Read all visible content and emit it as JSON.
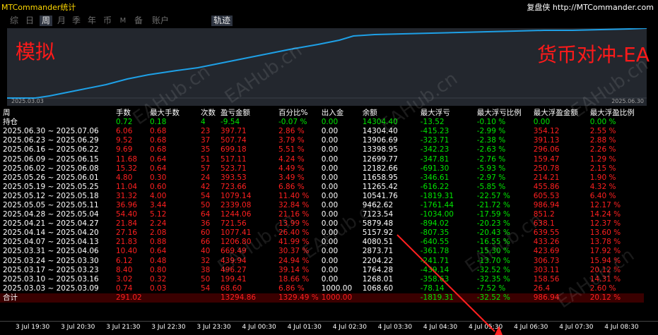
{
  "app": {
    "title": "MTCommander统计",
    "brand": "复盘侠",
    "url": "http://MTCommander.com"
  },
  "tabs": [
    "综",
    "日",
    "周",
    "月",
    "季",
    "年",
    "币",
    "M",
    "备",
    "账户",
    "轨迹"
  ],
  "active_tab": "周",
  "chart": {
    "label_left": "模拟",
    "label_right": "货币对冲-EA",
    "start_date": "2025.03.03",
    "end_date": "2025.06.30"
  },
  "watermark": "EAHub.cn",
  "table": {
    "headers": [
      "周",
      "手数",
      "最大手数",
      "次数",
      "盈亏金额",
      "百分比%",
      "出入金",
      "余额",
      "最大浮亏",
      "最大浮亏比例",
      "最大浮盈金额",
      "最大浮盈比例"
    ],
    "holdings": [
      "持仓",
      "0.72",
      "0.18",
      "4",
      "-9.54",
      "-0.07 %",
      "0.00",
      "14304.40",
      "-13.52",
      "-0.10 %",
      "0.00",
      "0.00 %"
    ],
    "rows": [
      [
        "2025.06.30 ~ 2025.07.06",
        "6.06",
        "0.68",
        "23",
        "397.71",
        "2.86 %",
        "0.00",
        "14304.40",
        "-415.23",
        "-2.99 %",
        "354.12",
        "2.55 %"
      ],
      [
        "2025.06.23 ~ 2025.06.29",
        "9.52",
        "0.68",
        "37",
        "507.74",
        "3.79 %",
        "0.00",
        "13906.69",
        "-323.71",
        "-2.38 %",
        "391.13",
        "2.88 %"
      ],
      [
        "2025.06.16 ~ 2025.06.22",
        "9.69",
        "0.68",
        "35",
        "699.18",
        "5.51 %",
        "0.00",
        "13398.95",
        "-342.23",
        "-2.63 %",
        "296.06",
        "2.26 %"
      ],
      [
        "2025.06.09 ~ 2025.06.15",
        "11.68",
        "0.64",
        "51",
        "517.11",
        "4.24 %",
        "0.00",
        "12699.77",
        "-347.81",
        "-2.76 %",
        "159.47",
        "1.29 %"
      ],
      [
        "2025.06.02 ~ 2025.06.08",
        "15.32",
        "0.64",
        "57",
        "523.71",
        "4.49 %",
        "0.00",
        "12182.66",
        "-691.30",
        "-5.93 %",
        "250.78",
        "2.15 %"
      ],
      [
        "2025.05.26 ~ 2025.06.01",
        "4.80",
        "0.30",
        "24",
        "393.53",
        "3.49 %",
        "0.00",
        "11658.95",
        "-346.61",
        "-2.97 %",
        "214.21",
        "1.90 %"
      ],
      [
        "2025.05.19 ~ 2025.05.25",
        "11.04",
        "0.60",
        "42",
        "723.66",
        "6.86 %",
        "0.00",
        "11265.42",
        "-616.22",
        "-5.85 %",
        "455.86",
        "4.32 %"
      ],
      [
        "2025.05.12 ~ 2025.05.18",
        "31.32",
        "4.00",
        "54",
        "1079.14",
        "11.40 %",
        "0.00",
        "10541.76",
        "-1819.31",
        "-22.57 %",
        "605.53",
        "6.40 %"
      ],
      [
        "2025.05.05 ~ 2025.05.11",
        "36.96",
        "3.44",
        "50",
        "2339.08",
        "32.84 %",
        "0.00",
        "9462.62",
        "-1761.44",
        "-21.72 %",
        "986.94",
        "12.17 %"
      ],
      [
        "2025.04.28 ~ 2025.05.04",
        "54.40",
        "5.12",
        "64",
        "1244.06",
        "21.16 %",
        "0.00",
        "7123.54",
        "-1034.00",
        "-17.59 %",
        "851.2",
        "14.24 %"
      ],
      [
        "2025.04.21 ~ 2025.04.27",
        "21.84",
        "2.24",
        "36",
        "721.56",
        "13.99 %",
        "0.00",
        "5879.48",
        "-894.02",
        "-20.23 %",
        "638.1",
        "12.37 %"
      ],
      [
        "2025.04.14 ~ 2025.04.20",
        "27.16",
        "2.08",
        "60",
        "1077.41",
        "26.40 %",
        "0.00",
        "5157.92",
        "-807.35",
        "-20.43 %",
        "639.55",
        "13.60 %"
      ],
      [
        "2025.04.07 ~ 2025.04.13",
        "21.83",
        "0.88",
        "66",
        "1206.80",
        "41.99 %",
        "0.00",
        "4080.51",
        "-640.55",
        "-16.55 %",
        "433.26",
        "13.78 %"
      ],
      [
        "2025.03.31 ~ 2025.04.06",
        "10.40",
        "0.64",
        "40",
        "669.49",
        "30.37 %",
        "0.00",
        "2873.71",
        "-361.78",
        "-15.30 %",
        "423.69",
        "17.92 %"
      ],
      [
        "2025.03.24 ~ 2025.03.30",
        "6.12",
        "0.48",
        "32",
        "439.94",
        "24.94 %",
        "0.00",
        "2204.22",
        "-241.71",
        "-13.70 %",
        "306.73",
        "15.94 %"
      ],
      [
        "2025.03.17 ~ 2025.03.23",
        "8.40",
        "0.80",
        "38",
        "496.27",
        "39.14 %",
        "0.00",
        "1764.28",
        "-439.14",
        "-32.52 %",
        "303.11",
        "20.12 %"
      ],
      [
        "2025.03.10 ~ 2025.03.16",
        "3.02",
        "0.32",
        "50",
        "199.41",
        "18.66 %",
        "0.00",
        "1268.01",
        "-358.63",
        "-32.35 %",
        "158.56",
        "14.31 %"
      ],
      [
        "2025.03.03 ~ 2025.03.09",
        "0.74",
        "0.03",
        "54",
        "68.60",
        "6.86 %",
        "1000.00",
        "1068.60",
        "-78.14",
        "-7.52 %",
        "26.4",
        "2.60 %"
      ]
    ],
    "total": [
      "合计",
      "291.02",
      "",
      "",
      "13294.86",
      "1329.49 %",
      "1000.00",
      "",
      "-1819.31",
      "-32.52 %",
      "986.94",
      "20.12 %"
    ]
  },
  "timeaxis": [
    "3 Jul 19:30",
    "3 Jul 20:30",
    "3 Jul 21:30",
    "3 Jul 22:30",
    "3 Jul 23:30",
    "4 Jul 00:30",
    "4 Jul 01:30",
    "4 Jul 02:30",
    "4 Jul 03:30",
    "4 Jul 04:30",
    "4 Jul 05:30",
    "4 Jul 06:30",
    "4 Jul 07:30",
    "4 Jul 08:30"
  ],
  "colors": {
    "equity_line": "#1ea0e6",
    "accent_red": "#ff1a1a",
    "positive": "#00e600",
    "title_yellow": "#ffd800",
    "chart_bg": "#23272e"
  }
}
